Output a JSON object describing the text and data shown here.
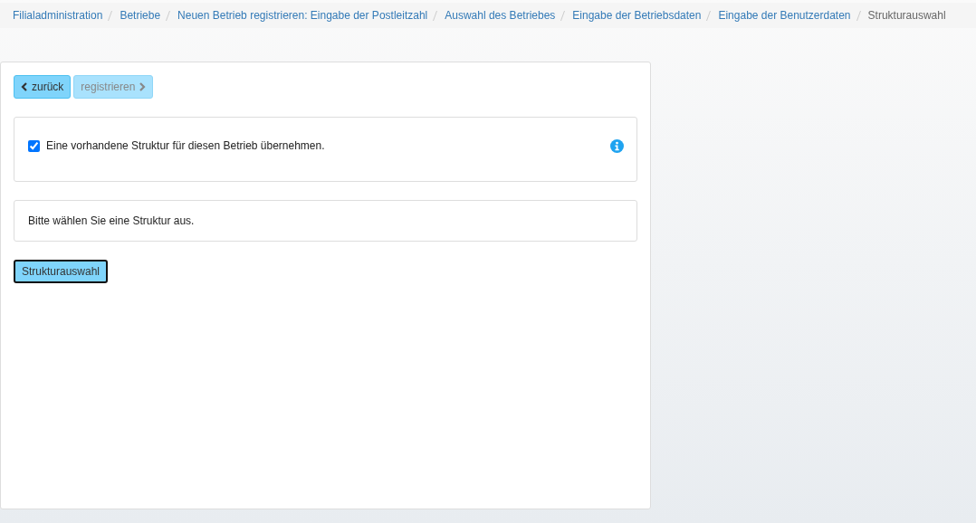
{
  "breadcrumb": [
    {
      "label": "Filialadministration",
      "current": false
    },
    {
      "label": "Betriebe",
      "current": false
    },
    {
      "label": "Neuen Betrieb registrieren: Eingabe der Postleitzahl",
      "current": false
    },
    {
      "label": "Auswahl des Betriebes",
      "current": false
    },
    {
      "label": "Eingabe der Betriebsdaten",
      "current": false
    },
    {
      "label": "Eingabe der Benutzerdaten",
      "current": false
    },
    {
      "label": "Strukturauswahl",
      "current": true
    }
  ],
  "toolbar": [
    {
      "label": "zurück",
      "kind": "back",
      "disabled": false
    },
    {
      "label": "registrieren",
      "kind": "forward",
      "disabled": true
    }
  ],
  "option": {
    "label": "Eine vorhandene Struktur für diesen Betrieb übernehmen.",
    "checked": true
  },
  "message": "Bitte wählen Sie eine Struktur aus.",
  "select_button": {
    "label": "Strukturauswahl",
    "focused": true
  }
}
